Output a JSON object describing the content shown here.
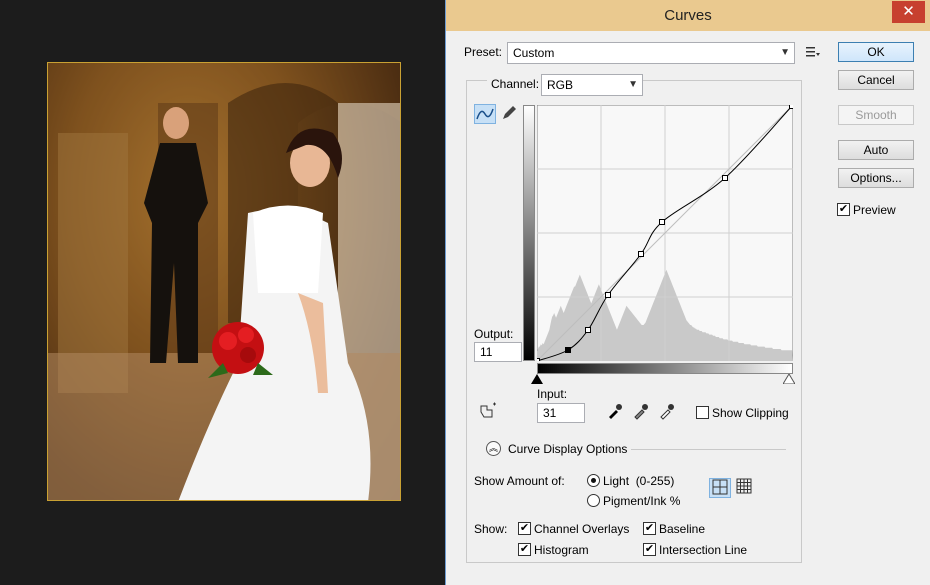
{
  "dialog": {
    "title": "Curves",
    "close_glyph": "✕",
    "preset_label": "Preset:",
    "preset_value": "Custom",
    "channel_label": "Channel:",
    "channel_value": "RGB",
    "output_label": "Output:",
    "output_value": "11",
    "input_label": "Input:",
    "input_value": "31",
    "show_clipping_label": "Show Clipping",
    "curve_display_options_label": "Curve Display Options",
    "show_amount_label": "Show Amount of:",
    "light_label": "Light  (0-255)",
    "pigment_label": "Pigment/Ink %",
    "show_label": "Show:",
    "channel_overlays_label": "Channel Overlays",
    "baseline_label": "Baseline",
    "histogram_label": "Histogram",
    "intersection_line_label": "Intersection Line",
    "check_glyph": "✔"
  },
  "buttons": {
    "ok": "OK",
    "cancel": "Cancel",
    "smooth": "Smooth",
    "auto": "Auto",
    "options": "Options...",
    "preview": "Preview"
  },
  "curve": {
    "points": [
      [
        0,
        0
      ],
      [
        31,
        11
      ],
      [
        51,
        31
      ],
      [
        71,
        66
      ],
      [
        104,
        107
      ],
      [
        125,
        139
      ],
      [
        188,
        183
      ],
      [
        255,
        255
      ]
    ],
    "histogram": [
      8,
      10,
      12,
      12,
      14,
      13,
      15,
      14,
      16,
      18,
      20,
      22,
      24,
      26,
      30,
      34,
      37,
      38,
      40,
      38,
      36,
      38,
      40,
      42,
      44,
      46,
      44,
      42,
      40,
      42,
      44,
      46,
      48,
      50,
      52,
      54,
      56,
      58,
      60,
      62,
      62,
      64,
      66,
      68,
      70,
      72,
      70,
      68,
      66,
      64,
      62,
      60,
      58,
      56,
      54,
      52,
      50,
      48,
      50,
      52,
      54,
      56,
      58,
      60,
      62,
      64,
      62,
      60,
      58,
      56,
      54,
      52,
      50,
      48,
      46,
      44,
      42,
      40,
      38,
      36,
      34,
      32,
      30,
      28,
      26,
      28,
      30,
      32,
      34,
      36,
      38,
      40,
      42,
      44,
      46,
      45,
      44,
      43,
      42,
      41,
      40,
      39,
      38,
      37,
      36,
      35,
      34,
      33,
      32,
      31,
      30,
      30,
      30,
      31,
      32,
      34,
      36,
      38,
      40,
      42,
      44,
      46,
      48,
      50,
      52,
      54,
      56,
      58,
      60,
      62,
      64,
      66,
      68,
      70,
      72,
      74,
      76,
      74,
      72,
      70,
      68,
      66,
      64,
      62,
      60,
      58,
      56,
      54,
      52,
      50,
      48,
      46,
      44,
      42,
      40,
      38,
      36,
      34,
      33,
      32,
      31,
      30,
      30,
      29,
      28,
      28,
      27,
      27,
      26,
      26,
      26,
      25,
      25,
      25,
      24,
      24,
      24,
      24,
      23,
      23,
      23,
      22,
      22,
      22,
      22,
      21,
      21,
      21,
      20,
      20,
      20,
      20,
      19,
      19,
      19,
      19,
      18,
      18,
      18,
      18,
      18,
      17,
      17,
      17,
      17,
      17,
      16,
      16,
      16,
      16,
      16,
      16,
      15,
      15,
      15,
      15,
      15,
      15,
      14,
      14,
      14,
      14,
      14,
      14,
      14,
      13,
      13,
      13,
      13,
      13,
      13,
      13,
      12,
      12,
      12,
      12,
      12,
      12,
      12,
      12,
      11,
      11,
      11,
      11,
      11,
      11,
      11,
      11,
      10,
      10,
      10,
      10,
      10,
      10,
      10,
      10,
      10,
      9,
      9,
      9,
      9,
      9,
      9,
      9,
      9,
      9,
      9,
      9,
      9
    ]
  },
  "icons": {
    "curve_tool": "curve-tool-icon",
    "pencil_tool": "pencil-icon",
    "preset_menu": "list-menu-icon",
    "on_image": "on-image-adjust-icon",
    "black_eyedropper": "eyedropper-icon",
    "gray_eyedropper": "eyedropper-icon",
    "white_eyedropper": "eyedropper-icon",
    "simple_grid": "grid-4-icon",
    "detailed_grid": "grid-10-icon",
    "expand": "chevron-up-icon"
  }
}
